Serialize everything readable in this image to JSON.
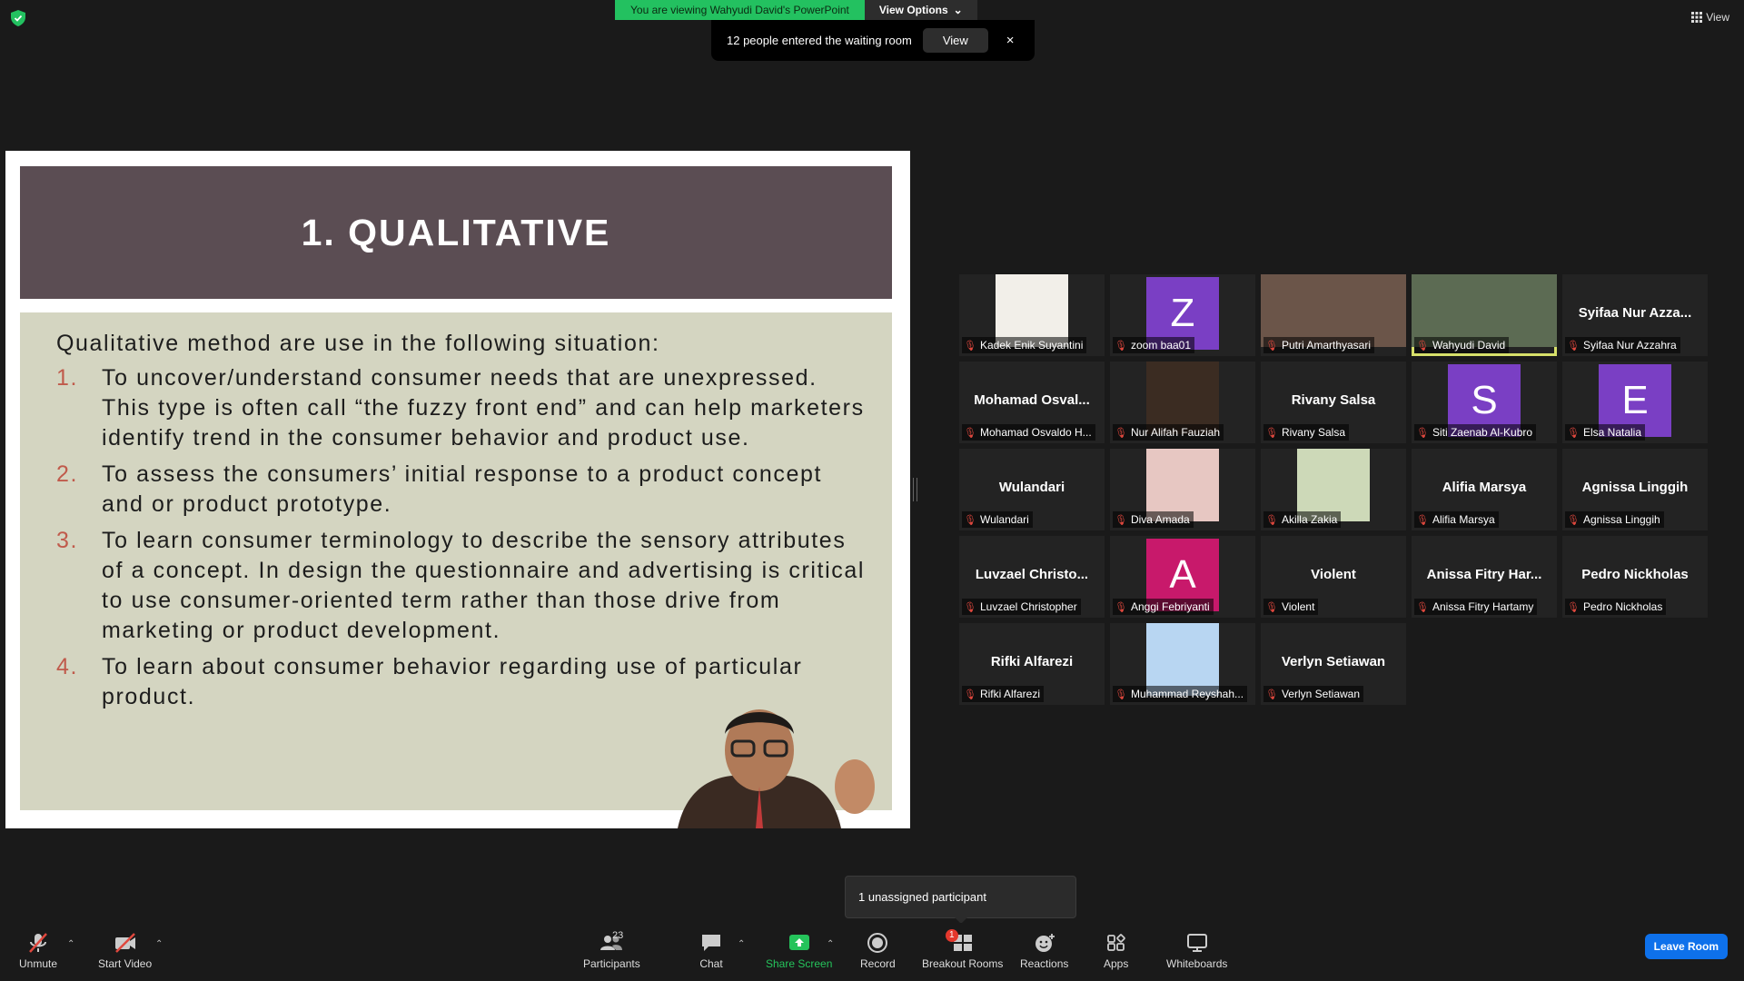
{
  "banner": {
    "viewing": "You are viewing Wahyudi David's PowerPoint",
    "view_options": "View Options"
  },
  "notification": {
    "message": "12 people entered the waiting room",
    "view_label": "View",
    "close_label": "×"
  },
  "top_right": {
    "view_label": "View"
  },
  "slide": {
    "title": "1. QUALITATIVE",
    "intro": "Qualitative method are use in the following situation:",
    "items": [
      {
        "num": "1.",
        "text": "To uncover/understand consumer needs that are unexpressed. This type is often call “the fuzzy front end” and can help marketers identify trend in the consumer behavior and product use."
      },
      {
        "num": "2.",
        "text": "To assess the consumers’ initial response to a product concept and or product prototype."
      },
      {
        "num": "3.",
        "text": "To learn consumer terminology to describe the sensory attributes of a concept. In design the questionnaire and advertising is critical to use consumer-oriented term rather than those drive from marketing or product development."
      },
      {
        "num": "4.",
        "text": "To learn about consumer behavior regarding use of particular product."
      }
    ]
  },
  "participants": [
    {
      "name": "Kadek Enik Suyantini",
      "display": "",
      "kind": "photo"
    },
    {
      "name": "zoom baa01",
      "display": "Z",
      "kind": "avatar",
      "color": "#7a3fc4"
    },
    {
      "name": "Putri Amarthyasari",
      "display": "",
      "kind": "photo"
    },
    {
      "name": "Wahyudi David",
      "display": "",
      "kind": "photo"
    },
    {
      "name": "Syifaa Nur Azzahra",
      "display": "Syifaa Nur Azza...",
      "kind": "text"
    },
    {
      "name": "Mohamad Osvaldo H...",
      "display": "Mohamad Osval...",
      "kind": "text"
    },
    {
      "name": "Nur Alifah Fauziah",
      "display": "",
      "kind": "photo"
    },
    {
      "name": "Rivany Salsa",
      "display": "Rivany Salsa",
      "kind": "text"
    },
    {
      "name": "Siti Zaenab Al-Kubro",
      "display": "S",
      "kind": "avatar",
      "color": "#7a3fc4"
    },
    {
      "name": "Elsa Natalia",
      "display": "E",
      "kind": "avatar",
      "color": "#7a3fc4"
    },
    {
      "name": "Wulandari",
      "display": "Wulandari",
      "kind": "text"
    },
    {
      "name": "Diva Amada",
      "display": "",
      "kind": "photo"
    },
    {
      "name": "Akilla Zakia",
      "display": "",
      "kind": "photo"
    },
    {
      "name": "Alifia Marsya",
      "display": "Alifia Marsya",
      "kind": "text"
    },
    {
      "name": "Agnissa Linggih",
      "display": "Agnissa Linggih",
      "kind": "text"
    },
    {
      "name": "Luvzael Christopher",
      "display": "Luvzael Christo...",
      "kind": "text"
    },
    {
      "name": "Anggi Febriyanti",
      "display": "A",
      "kind": "avatar",
      "color": "#c8196b"
    },
    {
      "name": "Violent",
      "display": "Violent",
      "kind": "text"
    },
    {
      "name": "Anissa Fitry Hartamy",
      "display": "Anissa Fitry Har...",
      "kind": "text"
    },
    {
      "name": "Pedro Nickholas",
      "display": "Pedro Nickholas",
      "kind": "text"
    },
    {
      "name": "Rifki Alfarezi",
      "display": "Rifki Alfarezi",
      "kind": "text"
    },
    {
      "name": "Muhammad Reyshah...",
      "display": "",
      "kind": "photo"
    },
    {
      "name": "Verlyn Setiawan",
      "display": "Verlyn Setiawan",
      "kind": "text"
    }
  ],
  "tooltip": {
    "text": "1 unassigned participant"
  },
  "toolbar": {
    "unmute": "Unmute",
    "start_video": "Start Video",
    "participants": "Participants",
    "participants_count": "23",
    "chat": "Chat",
    "share_screen": "Share Screen",
    "record": "Record",
    "breakout_rooms": "Breakout Rooms",
    "breakout_badge": "1",
    "reactions": "Reactions",
    "apps": "Apps",
    "whiteboards": "Whiteboards",
    "leave": "Leave Room"
  },
  "colors": {
    "accent_green": "#23c160",
    "leave_blue": "#0e71eb",
    "slide_title_bg": "#5b4d53",
    "slide_body_bg": "#d4d5c1"
  }
}
